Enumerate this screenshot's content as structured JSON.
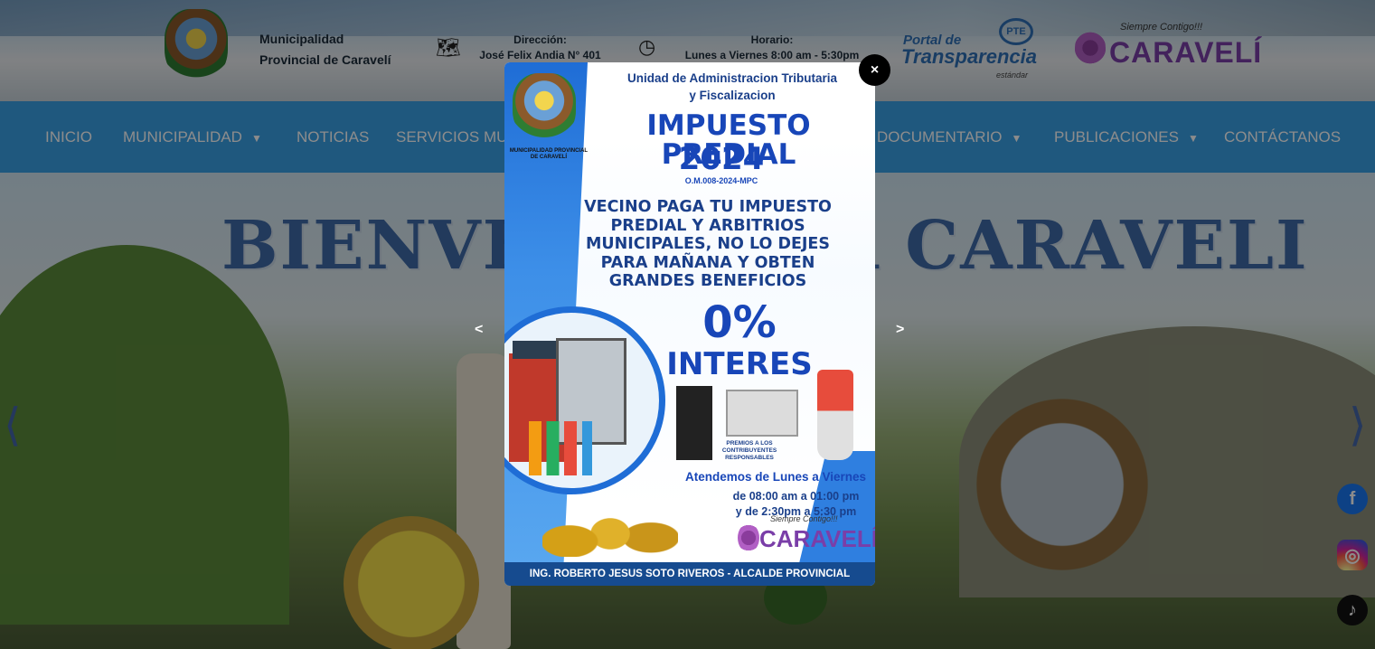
{
  "header": {
    "brand_line1": "Municipalidad",
    "brand_line2": "Provincial de Caravelí",
    "address_label": "Dirección:",
    "address_value": "José Felix Andia N° 401",
    "hours_label": "Horario:",
    "hours_value": "Lunes a Viernes 8:00 am - 5:30pm",
    "transparency_line1": "Portal de",
    "transparency_line2": "Transparencia",
    "transparency_line3": "estándar",
    "transparency_badge": "PTE",
    "caraveli_tagline": "Siempre Contigo!!!",
    "caraveli_name": "CARAVELÍ"
  },
  "nav": {
    "items": [
      {
        "label": "INICIO"
      },
      {
        "label": "MUNICIPALIDAD"
      },
      {
        "label": "NOTICIAS"
      },
      {
        "label": "SERVICIOS MU"
      },
      {
        "label": "DOCUMENTARIO"
      },
      {
        "label": "PUBLICACIONES"
      },
      {
        "label": "CONTÁCTANOS"
      }
    ]
  },
  "hero": {
    "title": "BIENVENIDOS A CARAVELI",
    "prev_icon": "chevron-left-icon",
    "next_icon": "chevron-right-icon"
  },
  "social": {
    "facebook": "f",
    "instagram": "◎",
    "tiktok": "♪"
  },
  "popup": {
    "close_label": "×",
    "prev_label": "<",
    "next_label": ">",
    "unit_line1": "Unidad de Administracion Tributaria",
    "unit_line2": "y Fiscalizacion",
    "crest_caption": "MUNICIPALIDAD PROVINCIAL DE CARAVELÍ",
    "title_line1": "IMPUESTO PREDIAL",
    "title_line2": "2024",
    "ordinance": "O.M.008-2024-MPC",
    "message_line1": "VECINO PAGA TU IMPUESTO",
    "message_line2": "PREDIAL Y ARBITRIOS",
    "message_line3": "MUNICIPALES, NO LO DEJES",
    "message_line4": "PARA MAÑANA Y OBTEN",
    "message_line5": "GRANDES BENEFICIOS",
    "percent": "0%",
    "interest": "INTERES",
    "prizes": "PREMIOS A LOS CONTRIBUYENTES RESPONSABLES",
    "attention": "Atendemos de Lunes a Viernes",
    "hours_line1": "de 08:00 am a 01:00 pm",
    "hours_line2": "y de 2:30pm a 5:30 pm",
    "tagline": "Siempre Contigo!!!",
    "brand": "CARAVELÍ",
    "footer": "ING. ROBERTO JESUS SOTO RIVEROS - ALCALDE PROVINCIAL"
  },
  "colors": {
    "nav_bg": "#3aa0e6",
    "popup_blue": "#1846b8",
    "close_bg": "#000000"
  }
}
